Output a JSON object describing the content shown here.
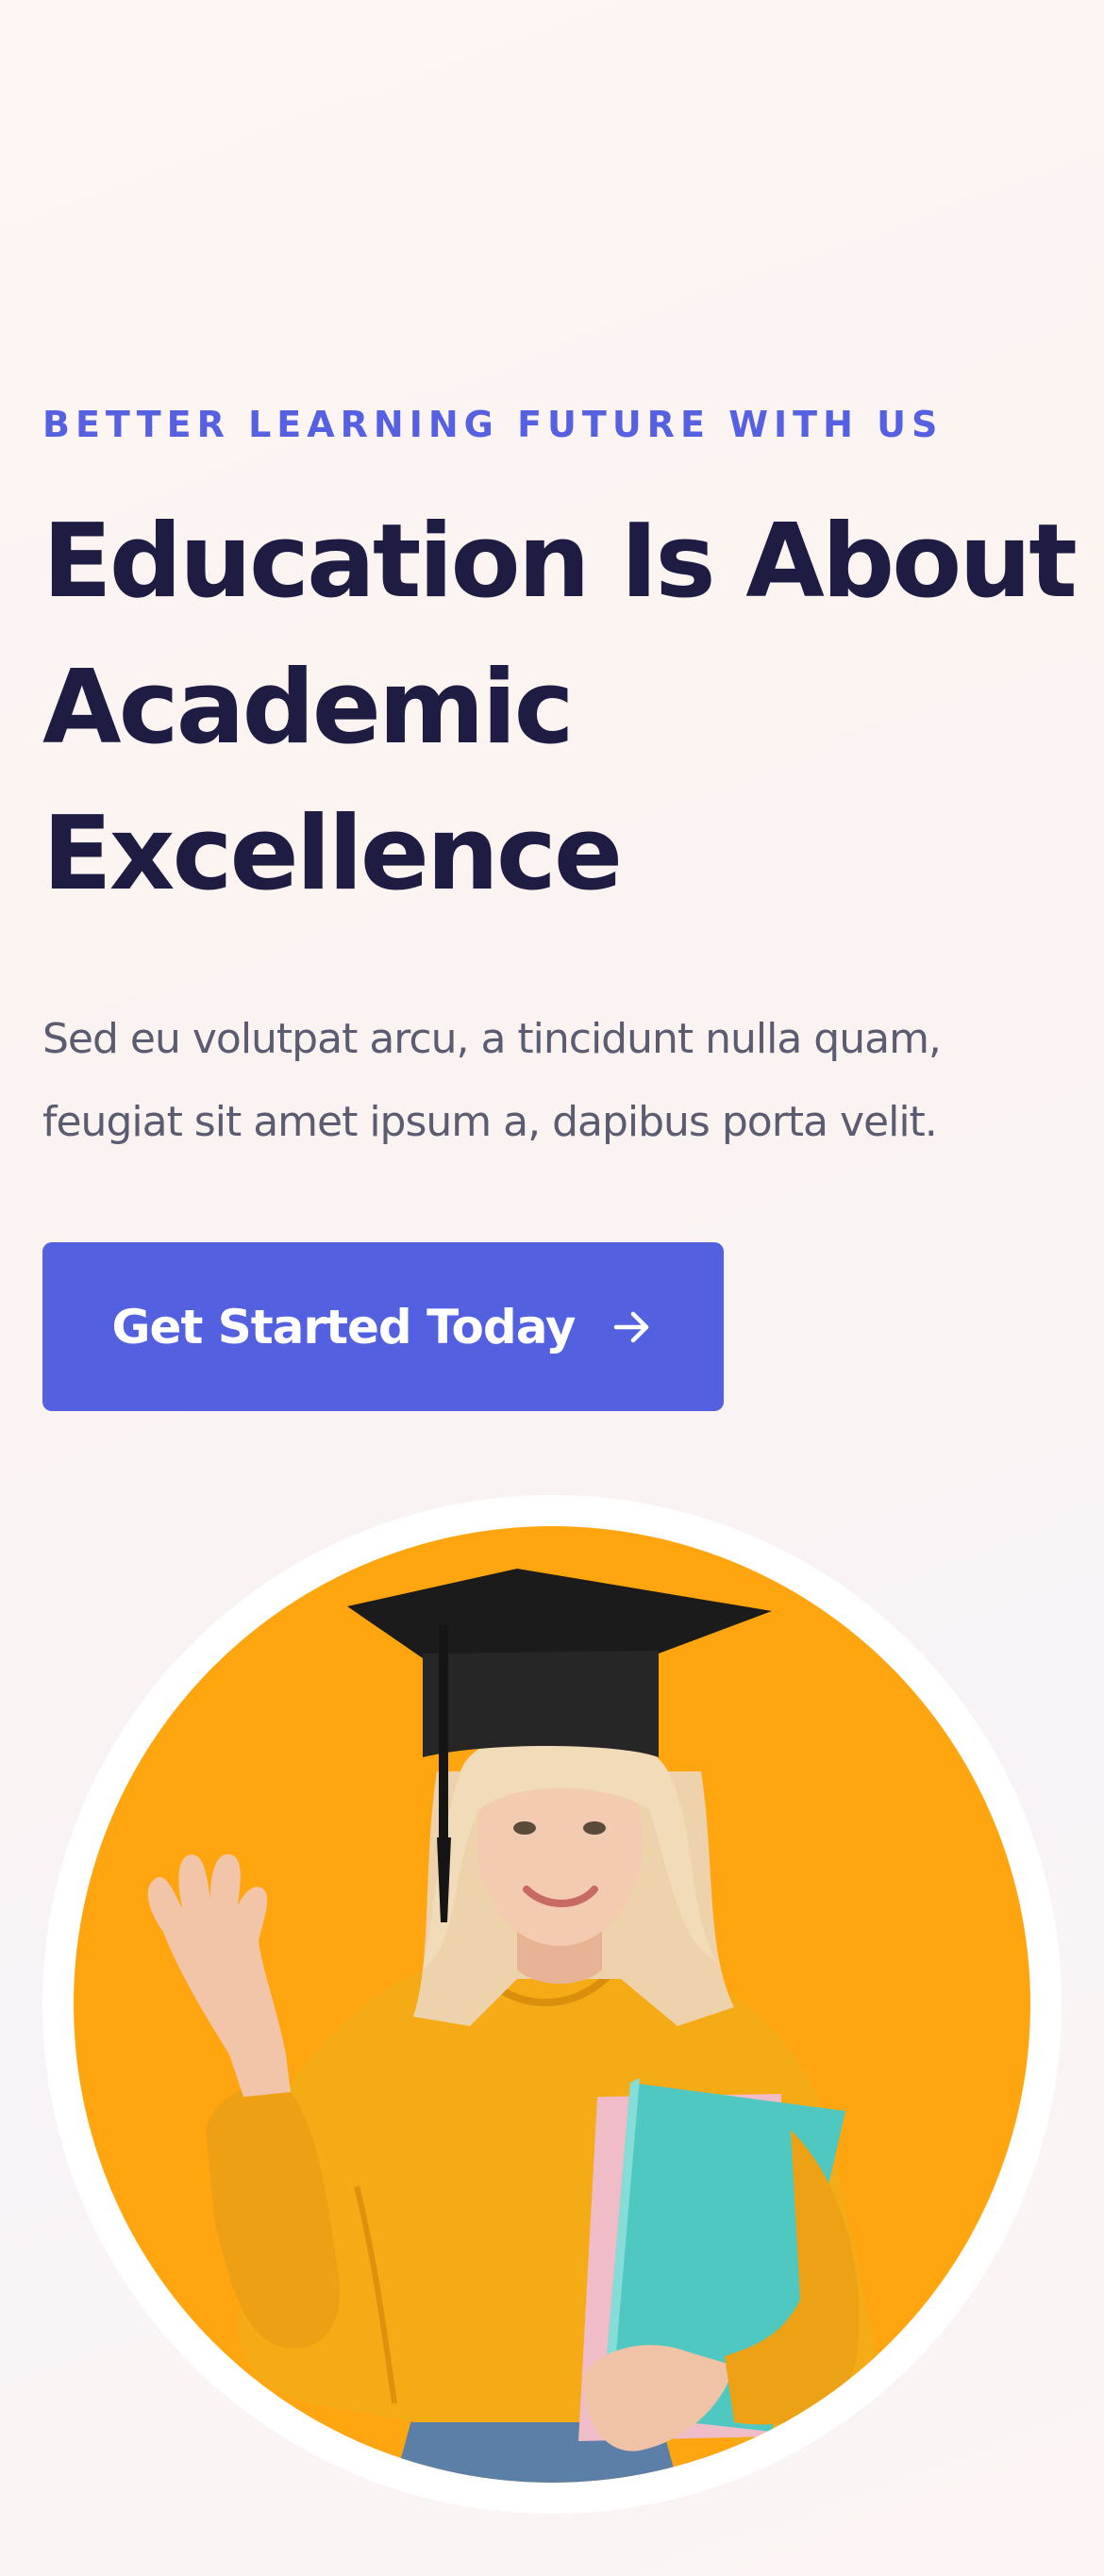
{
  "hero": {
    "eyebrow": "BETTER LEARNING FUTURE WITH US",
    "headline_lines": [
      "Education Is About",
      "Academic",
      "Excellence"
    ],
    "lead_lines": [
      "Sed eu volutpat arcu, a tincidunt nulla quam,",
      "feugiat sit amet ipsum a, dapibus porta velit."
    ],
    "cta": {
      "label": "Get Started Today",
      "icon": "arrow-right-icon"
    }
  },
  "image": {
    "subject": "graduate-student-photo",
    "background_color": "#ffa510",
    "ring_color": "#ffffff"
  },
  "colors": {
    "accent": "#5361e1",
    "heading": "#1e1c42",
    "body_text": "#5b5b71"
  }
}
